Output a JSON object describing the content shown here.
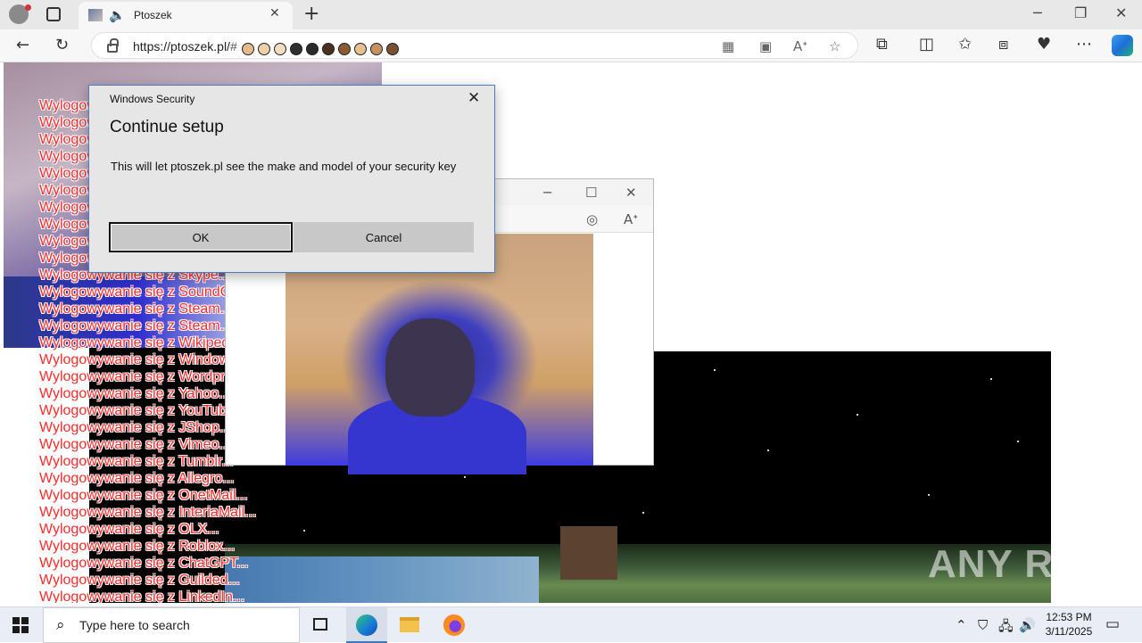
{
  "browser": {
    "tab_title": "Ptoszek",
    "url_host": "https://ptoszek.pl/",
    "url_rest": "#",
    "url_faces": [
      "#e6b98c",
      "#f0d0a8",
      "#f3dcc0",
      "#2f2f2f",
      "#2a2a2a",
      "#4a3020",
      "#8a5a30",
      "#e8c090",
      "#c89060",
      "#7a5030"
    ]
  },
  "logout_lines": [
    "Wylogowywanie się z ...",
    "Wylogowywanie się z ...",
    "Wylogowywanie się z ...",
    "Wylogowywanie się z ...",
    "Wylogowywanie się z ...",
    "Wylogowywanie się z ...",
    "Wylogowywanie się z ...",
    "Wylogowywanie się z ...",
    "Wylogowywanie się z ...",
    "Wylogowywanie się z ...",
    "Wylogowywanie się z Skype...",
    "Wylogowywanie się z SoundCloud...",
    "Wylogowywanie się z Steam...",
    "Wylogowywanie się z Steam...",
    "Wylogowywanie się z Wikipedia...",
    "Wylogowywanie się z Windows...",
    "Wylogowywanie się z Wordpress...",
    "Wylogowywanie się z Yahoo...",
    "Wylogowywanie się z YouTube...",
    "Wylogowywanie się z JShop...",
    "Wylogowywanie się z Vimeo...",
    "Wylogowywanie się z Tumblr...",
    "Wylogowywanie się z Allegro...",
    "Wylogowywanie się z OnetMail...",
    "Wylogowywanie się z InteriaMail...",
    "Wylogowywanie się z OLX...",
    "Wylogowywanie się z Roblox...",
    "Wylogowywanie się z ChatGPT...",
    "Wylogowywanie się z Guilded...",
    "Wylogowywanie się z LinkedIn..."
  ],
  "dialog": {
    "app_name": "Windows Security",
    "title": "Continue setup",
    "message": "This will let ptoszek.pl see the make and model of your security key",
    "ok_label": "OK",
    "cancel_label": "Cancel"
  },
  "watermark": "ANY RUN",
  "taskbar": {
    "search_placeholder": "Type here to search",
    "time": "12:53 PM",
    "date": "3/11/2025"
  }
}
